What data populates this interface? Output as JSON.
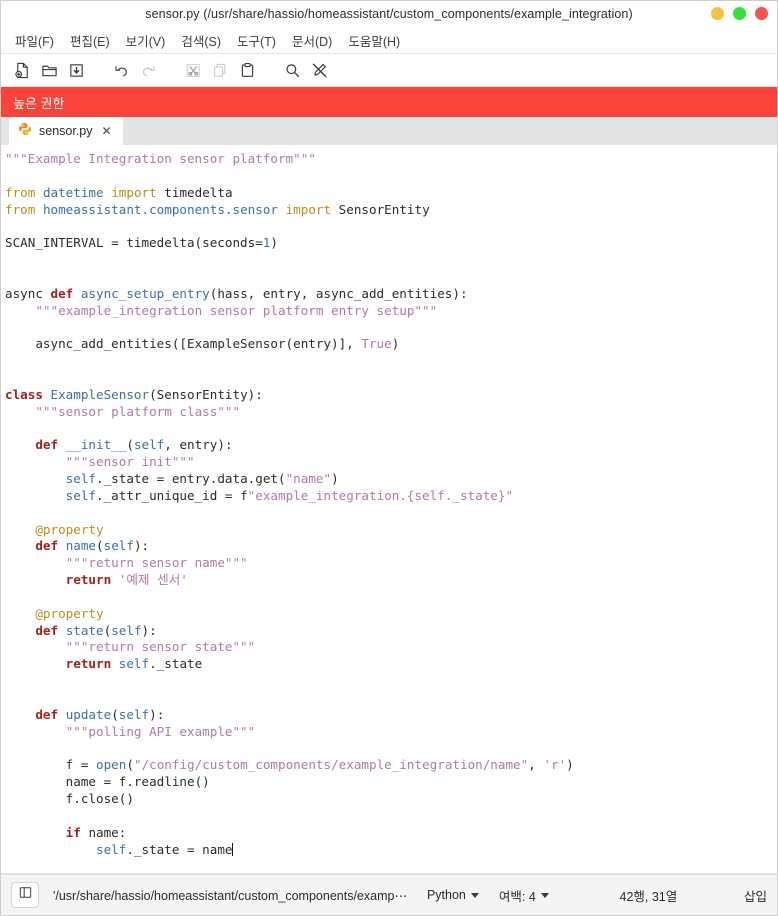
{
  "window": {
    "title": "sensor.py (/usr/share/hassio/homeassistant/custom_components/example_integration)",
    "buttons": [
      {
        "name": "minimize",
        "color": "#f6c144"
      },
      {
        "name": "maximize",
        "color": "#3ade3a"
      },
      {
        "name": "close",
        "color": "#f6504f"
      }
    ]
  },
  "menubar": {
    "items": [
      {
        "label": "파일(F)"
      },
      {
        "label": "편집(E)"
      },
      {
        "label": "보기(V)"
      },
      {
        "label": "검색(S)"
      },
      {
        "label": "도구(T)"
      },
      {
        "label": "문서(D)"
      },
      {
        "label": "도움말(H)"
      }
    ]
  },
  "toolbar": {
    "items": [
      {
        "icon": "new-file-icon",
        "enabled": true
      },
      {
        "icon": "open-folder-icon",
        "enabled": true
      },
      {
        "icon": "save-icon",
        "enabled": true
      },
      {
        "icon": "undo-icon",
        "enabled": true
      },
      {
        "icon": "redo-icon",
        "enabled": false
      },
      {
        "icon": "cut-icon",
        "enabled": false
      },
      {
        "icon": "copy-icon",
        "enabled": false
      },
      {
        "icon": "paste-icon",
        "enabled": true
      },
      {
        "icon": "search-icon",
        "enabled": true
      },
      {
        "icon": "clear-highlight-icon",
        "enabled": true
      }
    ]
  },
  "banner": {
    "text": "높은 권한",
    "background": "#f9423a",
    "foreground": "#ffffff"
  },
  "tabs": [
    {
      "label": "sensor.py",
      "icon": "python-icon",
      "close_label": "✕",
      "active": true
    }
  ],
  "editor": {
    "language": "Python",
    "cursor_line": 42,
    "cursor_column": 31,
    "code_lines": [
      "\"\"\"Example Integration sensor platform\"\"\"",
      "",
      "from datetime import timedelta",
      "from homeassistant.components.sensor import SensorEntity",
      "",
      "SCAN_INTERVAL = timedelta(seconds=1)",
      "",
      "",
      "async def async_setup_entry(hass, entry, async_add_entities):",
      "    \"\"\"example_integration sensor platform entry setup\"\"\"",
      "",
      "    async_add_entities([ExampleSensor(entry)], True)",
      "",
      "",
      "class ExampleSensor(SensorEntity):",
      "    \"\"\"sensor platform class\"\"\"",
      "",
      "    def __init__(self, entry):",
      "        \"\"\"sensor init\"\"\"",
      "        self._state = entry.data.get(\"name\")",
      "        self._attr_unique_id = f\"example_integration.{self._state}\"",
      "",
      "    @property",
      "    def name(self):",
      "        \"\"\"return sensor name\"\"\"",
      "        return '예제 센서'",
      "",
      "    @property",
      "    def state(self):",
      "        \"\"\"return sensor state\"\"\"",
      "        return self._state",
      "",
      "",
      "    def update(self):",
      "        \"\"\"polling API example\"\"\"",
      "",
      "        f = open(\"/config/custom_components/example_integration/name\", 'r')",
      "        name = f.readline()",
      "        f.close()",
      "",
      "        if name:",
      "            self._state = name"
    ],
    "colors": {
      "keyword": "#a52019",
      "import_keyword": "#bf8c17",
      "identifier": "#3c6fa8",
      "string": "#b07aa8",
      "number": "#3c6fa8",
      "plain": "#2b2b2b",
      "background": "#ffffff"
    }
  },
  "statusbar": {
    "toggle_icon": "sidebar-toggle-icon",
    "path": "'/usr/share/hassio/homeassistant/custom_components/examp⋯",
    "language": "Python",
    "indent": "여백: 4",
    "position": "42행, 31열",
    "mode": "삽입"
  }
}
